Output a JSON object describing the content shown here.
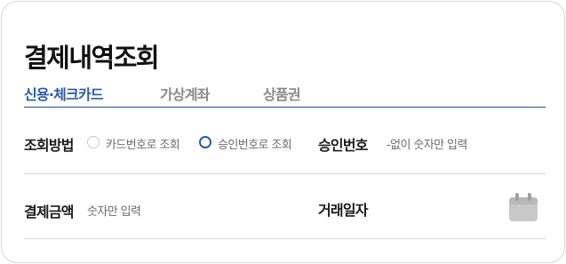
{
  "page": {
    "title": "결제내역조회"
  },
  "tabs": [
    {
      "label": "신용·체크카드",
      "active": true
    },
    {
      "label": "가상계좌",
      "active": false
    },
    {
      "label": "상품권",
      "active": false
    }
  ],
  "lookup_method": {
    "label": "조회방법",
    "options": [
      {
        "label": "카드번호로 조회",
        "selected": false
      },
      {
        "label": "승인번호로 조회",
        "selected": true
      }
    ]
  },
  "approval_number": {
    "label": "승인번호",
    "placeholder": "-없이 숫자만 입력"
  },
  "payment_amount": {
    "label": "결제금액",
    "placeholder": "숫자만 입력"
  },
  "transaction_date": {
    "label": "거래일자",
    "icon": "calendar-icon"
  },
  "colors": {
    "accent": "#2a5aa8",
    "tab_underline": "#1e4f83",
    "inactive_tab": "#8a8a8a",
    "placeholder": "#6b6b6b",
    "calendar_icon": "#c8c8c8"
  }
}
